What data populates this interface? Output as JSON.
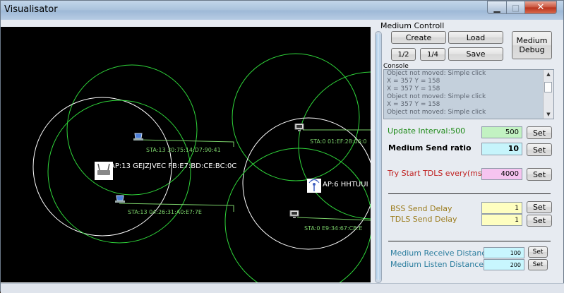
{
  "window": {
    "title": "Visualisator",
    "minimize_glyph": "▁",
    "maximize_glyph": "□",
    "close_glyph": "✕"
  },
  "canvas": {
    "ap_nodes": [
      {
        "label": "AP:13 GEJZJVEC FB:E7:BD:CE:BC:0C",
        "icon": "router-icon"
      },
      {
        "label": "AP:6 HHTUUI",
        "icon": "antenna-icon"
      }
    ],
    "sta_nodes": [
      {
        "label": "STA:13 30:75:14:D7:90:41",
        "icon": "laptop-icon"
      },
      {
        "label": "STA:13 04:26:31:A0:E7:7E",
        "icon": "laptop-icon"
      },
      {
        "label": "STA:0 01:EF:28:06:0",
        "icon": "monitor-icon"
      },
      {
        "label": "STA:0 E9:34:67:CB:E",
        "icon": "monitor-icon"
      }
    ]
  },
  "medium": {
    "group_title": "Medium Controll",
    "create_label": "Create",
    "load_label": "Load",
    "save_label": "Save",
    "half_label": "1/2",
    "quarter_label": "1/4",
    "debug_label": "Medium Debug",
    "console_label": "Console",
    "console_lines": [
      "Object not moved: Simple click",
      "X = 357    Y = 158",
      "X = 357    Y = 158",
      "Object not moved: Simple click",
      "X = 357    Y = 158",
      "Object not moved: Simple click"
    ]
  },
  "settings": {
    "set_label": "Set",
    "update_interval_label": "Update Interval:500",
    "update_interval_value": "500",
    "send_ratio_label": "Medium Send ratio",
    "send_ratio_value": "10",
    "tdls_label": "Try Start TDLS every(ms)",
    "tdls_value": "4000",
    "bss_delay_label": "BSS Send Delay",
    "bss_delay_value": "1",
    "tdls_delay_label": "TDLS Send Delay",
    "tdls_delay_value": "1",
    "receive_distance_label": "Medium Receive Distance",
    "receive_distance_value": "100",
    "listen_distance_label": "Medium Listen Distance",
    "listen_distance_value": "200"
  },
  "colors": {
    "range_green": "#2fd53a",
    "range_white": "#ffffff",
    "canvas_bg": "#000000"
  }
}
